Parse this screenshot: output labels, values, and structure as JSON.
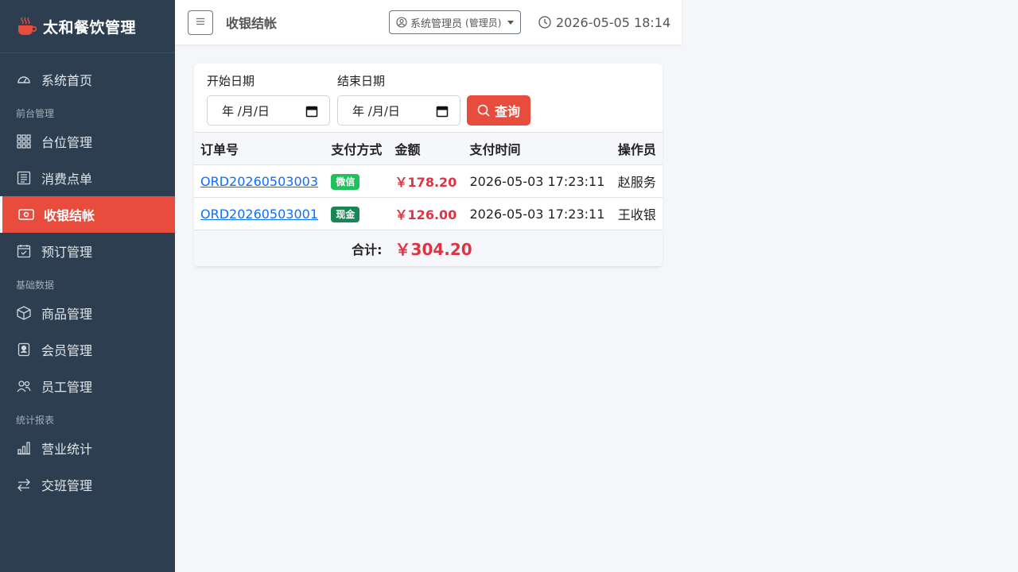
{
  "app": {
    "title": "太和餐饮管理",
    "icon": "coffee-cup-icon",
    "brand_color": "#e74c3c"
  },
  "sidebar": {
    "items": [
      {
        "label": "系统首页",
        "icon": "dashboard-icon"
      },
      {
        "section": "前台管理"
      },
      {
        "label": "台位管理",
        "icon": "grid-icon"
      },
      {
        "label": "消费点单",
        "icon": "receipt-icon"
      },
      {
        "label": "收银结帐",
        "icon": "cash-icon",
        "active": true
      },
      {
        "label": "预订管理",
        "icon": "calendar-check-icon"
      },
      {
        "section": "基础数据"
      },
      {
        "label": "商品管理",
        "icon": "box-icon"
      },
      {
        "label": "会员管理",
        "icon": "member-card-icon"
      },
      {
        "label": "员工管理",
        "icon": "people-icon"
      },
      {
        "section": "统计报表"
      },
      {
        "label": "营业统计",
        "icon": "bar-chart-icon"
      },
      {
        "label": "交班管理",
        "icon": "swap-arrows-icon"
      }
    ]
  },
  "topbar": {
    "menu_icon": "hamburger-icon",
    "page_title": "收银结帐",
    "user_label": "系统管理员",
    "user_role": "(管理员)",
    "datetime": "2026-05-05 18:14"
  },
  "filters": {
    "start_label": "开始日期",
    "end_label": "结束日期",
    "start_value": "年 /月/日",
    "end_value": "年 /月/日",
    "query_label": "查询"
  },
  "table": {
    "headers": [
      "订单号",
      "支付方式",
      "金额",
      "支付时间",
      "操作员"
    ],
    "rows": [
      {
        "order": "ORD20260503003",
        "pay": "微信",
        "pay_color": "#20c05c",
        "amount": "￥178.20",
        "time": "2026-05-03 17:23:11",
        "operator": "赵服务"
      },
      {
        "order": "ORD20260503001",
        "pay": "现金",
        "pay_color": "#198754",
        "amount": "￥126.00",
        "time": "2026-05-03 17:23:11",
        "operator": "王收银"
      }
    ],
    "total_label": "合计:",
    "total_value": "￥304.20"
  }
}
